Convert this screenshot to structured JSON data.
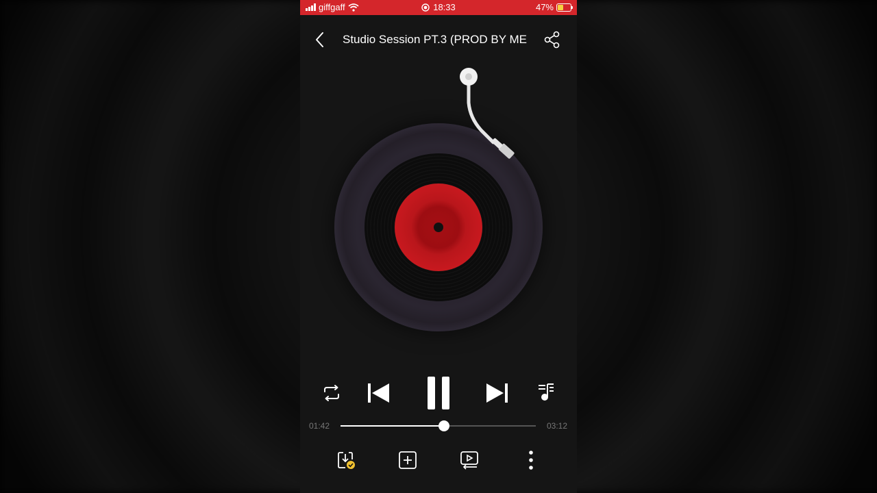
{
  "status": {
    "carrier": "giffgaff",
    "time": "18:33",
    "battery": "47%",
    "battery_level": 0.47
  },
  "player": {
    "title": "Studio Session PT.3 (PROD BY ME",
    "elapsed": "01:42",
    "duration": "03:12",
    "progress": 0.53
  },
  "icons": {
    "back": "chevron-left-icon",
    "share": "share-icon",
    "repeat": "repeat-icon",
    "previous": "skip-previous-icon",
    "pause": "pause-icon",
    "next": "skip-next-icon",
    "queue": "playlist-icon",
    "download": "download-done-icon",
    "add": "add-to-playlist-icon",
    "video": "music-video-icon",
    "more": "more-vertical-icon"
  },
  "colors": {
    "status_bar": "#d4262b",
    "record_label": "#c8191f"
  }
}
